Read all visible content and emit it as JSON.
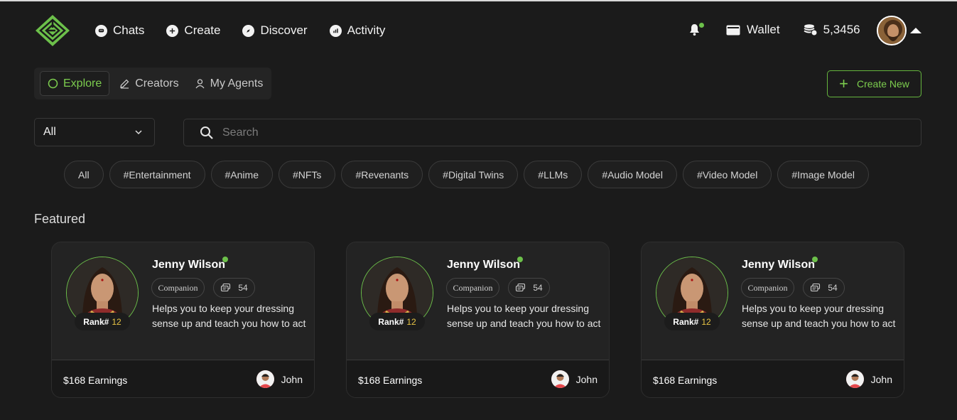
{
  "header": {
    "nav": [
      {
        "label": "Chats",
        "icon": "chat-icon"
      },
      {
        "label": "Create",
        "icon": "plus-circle-icon"
      },
      {
        "label": "Discover",
        "icon": "compass-icon"
      },
      {
        "label": "Activity",
        "icon": "chart-icon"
      }
    ],
    "wallet_label": "Wallet",
    "coin_balance": "5,3456"
  },
  "tabs": [
    {
      "label": "Explore",
      "icon": "circle-icon",
      "active": true
    },
    {
      "label": "Creators",
      "icon": "pen-icon"
    },
    {
      "label": "My Agents",
      "icon": "user-icon"
    }
  ],
  "create_new_label": "Create New",
  "filter": {
    "selected": "All",
    "search_placeholder": "Search"
  },
  "chips": [
    "All",
    "#Entertainment",
    "#Anime",
    "#NFTs",
    "#Revenants",
    "#Digital Twins",
    "#LLMs",
    "#Audio Model",
    "#Video Model",
    "#Image Model"
  ],
  "featured_title": "Featured",
  "cards": [
    {
      "name": "Jenny Wilson",
      "type": "Companion",
      "chats": "54",
      "description": "Helps you to keep your dressing sense up and teach you how to act",
      "rank_label": "Rank#",
      "rank": "12",
      "earnings": "$168 Earnings",
      "creator": "John"
    },
    {
      "name": "Jenny Wilson",
      "type": "Companion",
      "chats": "54",
      "description": "Helps you to keep your dressing sense up and teach you how to act",
      "rank_label": "Rank#",
      "rank": "12",
      "earnings": "$168 Earnings",
      "creator": "John"
    },
    {
      "name": "Jenny Wilson",
      "type": "Companion",
      "chats": "54",
      "description": "Helps you to keep your dressing sense up and teach you how to act",
      "rank_label": "Rank#",
      "rank": "12",
      "earnings": "$168 Earnings",
      "creator": "John"
    }
  ],
  "colors": {
    "accent": "#6cc04a",
    "background": "#1b1b1b",
    "card": "#232323",
    "rank_number": "#e9c545"
  }
}
